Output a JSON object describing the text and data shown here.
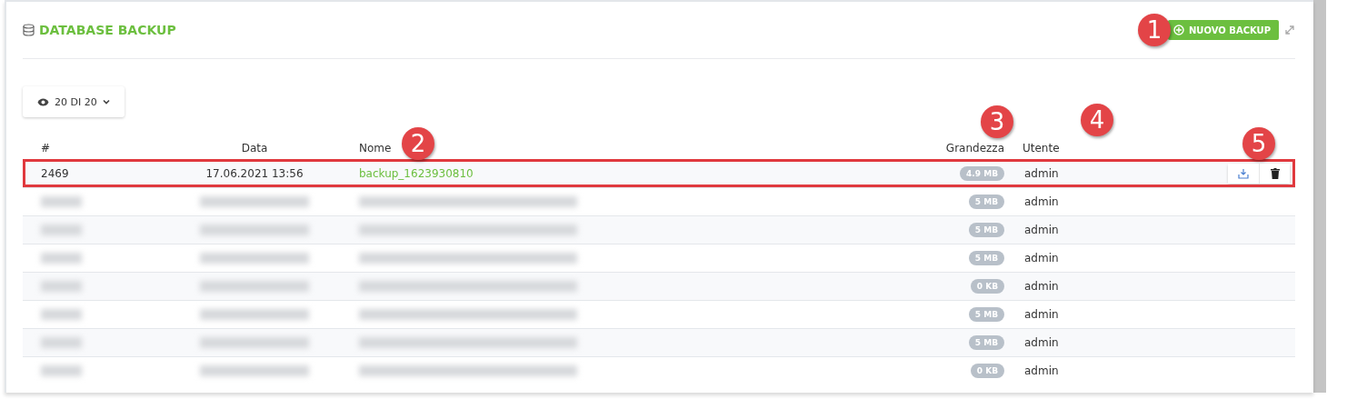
{
  "panel": {
    "title": "DATABASE BACKUP",
    "new_button": "NUOVO BACKUP"
  },
  "filter": {
    "label": "20 DI 20"
  },
  "table": {
    "columns": [
      "#",
      "Data",
      "Nome",
      "Grandezza",
      "Utente"
    ],
    "rows": [
      {
        "kind": "visible",
        "highlighted": true,
        "id": "2469",
        "date": "17.06.2021 13:56",
        "name": "backup_1623930810",
        "size": "4.9 MB",
        "user": "admin"
      },
      {
        "kind": "redacted",
        "highlighted": false,
        "size": "5 MB",
        "user": "admin"
      },
      {
        "kind": "redacted",
        "highlighted": false,
        "size": "5 MB",
        "user": "admin"
      },
      {
        "kind": "redacted",
        "highlighted": false,
        "size": "5 MB",
        "user": "admin"
      },
      {
        "kind": "redacted",
        "highlighted": false,
        "size": "0 KB",
        "user": "admin"
      },
      {
        "kind": "redacted",
        "highlighted": false,
        "size": "5 MB",
        "user": "admin"
      },
      {
        "kind": "redacted",
        "highlighted": false,
        "size": "5 MB",
        "user": "admin"
      },
      {
        "kind": "redacted",
        "highlighted": false,
        "size": "0 KB",
        "user": "admin"
      }
    ]
  },
  "callouts": [
    "1",
    "2",
    "3",
    "4",
    "5"
  ]
}
